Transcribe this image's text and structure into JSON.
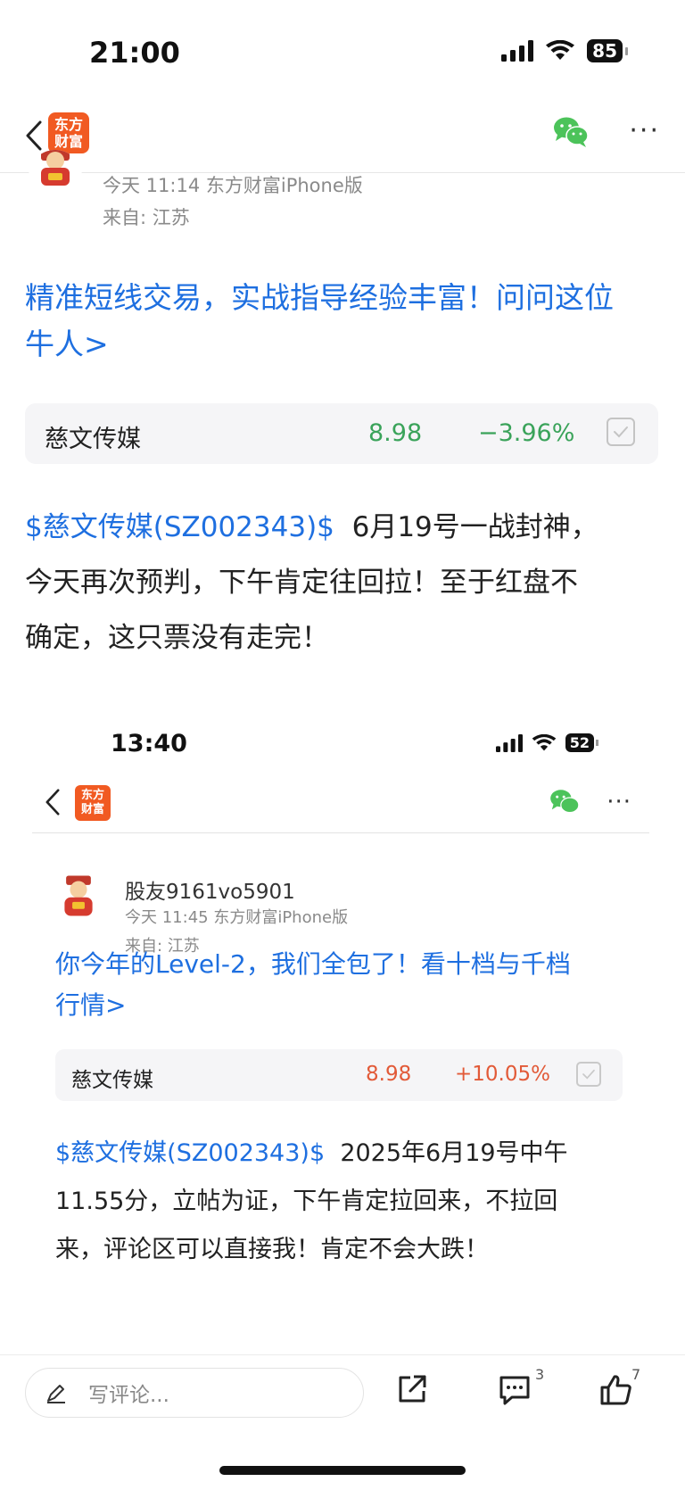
{
  "status_bar": {
    "time": "21:00",
    "battery": "85"
  },
  "nav": {
    "logo_line1": "东方",
    "logo_line2": "财富"
  },
  "post": {
    "meta_time": "今天 11:14 东方财富iPhone版",
    "meta_location": "来自: 江苏",
    "promo_line1": "精准短线交易，实战指导经验丰富！问问这位",
    "promo_line2": "牛人>",
    "stock": {
      "name": "慈文传媒",
      "price": "8.98",
      "change": "−3.96%",
      "color": "#3aa35a"
    },
    "cashtag": "$慈文传媒(SZ002343)$",
    "body_line1": "6月19号一战封神，",
    "body_line2": "今天再次预判，下午肯定往回拉！至于红盘不",
    "body_line3": "确定，这只票没有走完！"
  },
  "embedded_screenshot": {
    "time": "13:40",
    "battery": "52",
    "logo_line1": "东方",
    "logo_line2": "财富",
    "username": "股友9161vo5901",
    "meta_time": "今天 11:45 东方财富iPhone版",
    "meta_location": "来自: 江苏",
    "promo_line1": "你今年的Level-2，我们全包了！看十档与千档",
    "promo_line2": "行情>",
    "stock": {
      "name": "慈文传媒",
      "price": "8.98",
      "change": "+10.05%",
      "color": "#e25a38"
    },
    "cashtag": "$慈文传媒(SZ002343)$",
    "body_line1": "2025年6月19号中午",
    "body_line2": "11.55分，立帖为证，下午肯定拉回来，不拉回",
    "body_line3": "来，评论区可以直接我！肯定不会大跌！"
  },
  "bottom_bar": {
    "comment_placeholder": "写评论...",
    "comment_count": "3",
    "like_count": "7"
  },
  "colors": {
    "link_blue": "#1e6fe0",
    "brand_orange": "#f15a22",
    "wechat_green": "#4cc35a"
  }
}
